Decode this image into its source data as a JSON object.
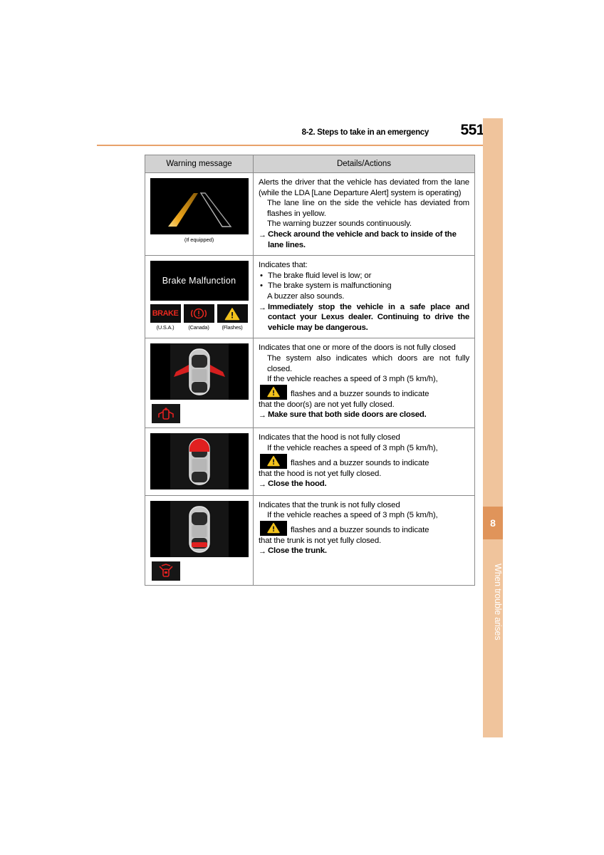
{
  "header": {
    "section": "8-2. Steps to take in an emergency",
    "page_number": "551"
  },
  "side_tab": {
    "chapter_number": "8",
    "chapter_label": "When trouble arises",
    "strip_color": "#f0c49c",
    "block_color": "#e0945a"
  },
  "table": {
    "columns": [
      "Warning message",
      "Details/Actions"
    ],
    "rows": [
      {
        "id": "lda-warning",
        "image": {
          "type": "lane-departure-display",
          "caption": "(If equipped)",
          "left_lane_color": "#e8a020",
          "right_lane_color": "#d8d8d8"
        },
        "details": {
          "intro": "Alerts the driver that the vehicle has deviated from the lane (while the LDA [Lane Departure Alert] system is operating)",
          "sub_lines": [
            "The lane line on the side the vehicle has deviated from flashes in yellow.",
            "The warning buzzer sounds continuously."
          ],
          "action": "Check around the vehicle and back to inside of the lane lines."
        }
      },
      {
        "id": "brake-malfunction",
        "image": {
          "type": "text-display",
          "display_text": "Brake Malfunction",
          "indicators": [
            {
              "icon": "brake-word-icon",
              "label": "BRAKE",
              "caption": "(U.S.A.)",
              "color": "#e8281e"
            },
            {
              "icon": "brake-circle-icon",
              "label": "",
              "caption": "(Canada)",
              "color": "#e8281e"
            },
            {
              "icon": "warning-triangle-icon",
              "label": "",
              "caption": "(Flashes)",
              "color": "#f2c21c"
            }
          ]
        },
        "details": {
          "intro": "Indicates that:",
          "bullets": [
            "The brake fluid level is low; or",
            "The brake system is malfunctioning"
          ],
          "sub_lines": [
            "A buzzer also sounds."
          ],
          "action": "Immediately stop the vehicle in a safe place and contact your Lexus dealer. Continuing to drive the vehicle may be dangerous."
        }
      },
      {
        "id": "door-open-warning",
        "image": {
          "type": "car-topview-display",
          "highlight": "front-doors",
          "highlight_color": "#e02020",
          "ajar_icon": "door-ajar-icon"
        },
        "details": {
          "intro": "Indicates that one or more of the doors is not fully closed",
          "sub_lines": [
            "The system also indicates which doors are not fully closed.",
            "If the vehicle reaches a speed of 3 mph (5 km/h),"
          ],
          "icon_sentence_tail": "flashes and a buzzer sounds to indicate",
          "icon_sentence_after": "that the door(s) are not yet fully closed.",
          "action": "Make sure that both side doors are closed."
        }
      },
      {
        "id": "hood-open-warning",
        "image": {
          "type": "car-topview-display",
          "highlight": "hood",
          "highlight_color": "#e02020",
          "ajar_icon": ""
        },
        "details": {
          "intro": "Indicates that the hood is not fully closed",
          "sub_lines": [
            "If the vehicle reaches a speed of 3 mph (5 km/h),"
          ],
          "icon_sentence_tail": "flashes and a buzzer sounds to indicate",
          "icon_sentence_after": "that the hood is not yet fully closed.",
          "action": "Close the hood."
        }
      },
      {
        "id": "trunk-open-warning",
        "image": {
          "type": "car-topview-display",
          "highlight": "trunk",
          "highlight_color": "#e02020",
          "ajar_icon": "trunk-ajar-icon"
        },
        "details": {
          "intro": "Indicates that the trunk is not fully closed",
          "sub_lines": [
            "If the vehicle reaches a speed of 3 mph (5 km/h),"
          ],
          "icon_sentence_tail": "flashes and a buzzer sounds to indicate",
          "icon_sentence_after": "that the trunk is not yet fully closed.",
          "action": "Close the trunk."
        }
      }
    ]
  },
  "symbols": {
    "arrow": "→",
    "bullet": "•"
  }
}
